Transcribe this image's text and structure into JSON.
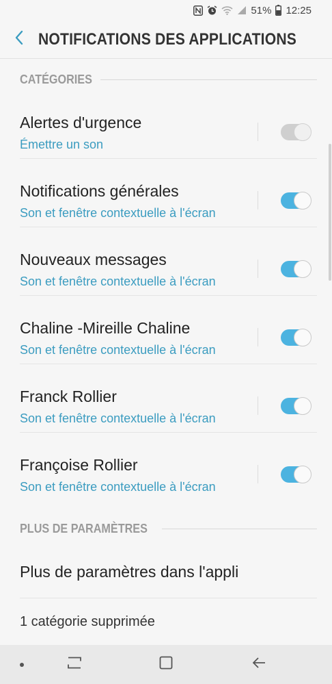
{
  "status_bar": {
    "battery": "51%",
    "time": "12:25",
    "icons": [
      "nfc-icon",
      "alarm-icon",
      "wifi-icon",
      "signal-icon",
      "battery-icon"
    ]
  },
  "header": {
    "back_icon": "chevron-left-icon",
    "title": "NOTIFICATIONS DES APPLICATIONS"
  },
  "sections": {
    "categories": "CATÉGORIES",
    "more_settings": "PLUS DE PARAMÈTRES"
  },
  "categories": [
    {
      "title": "Alertes d'urgence",
      "subtitle": "Émettre un son",
      "enabled": true,
      "toggle_disabled": true
    },
    {
      "title": "Notifications générales",
      "subtitle": "Son et fenêtre contextuelle à l'écran",
      "enabled": true,
      "toggle_disabled": false
    },
    {
      "title": "Nouveaux messages",
      "subtitle": "Son et fenêtre contextuelle à l'écran",
      "enabled": true,
      "toggle_disabled": false
    },
    {
      "title": "Chaline -Mireille Chaline",
      "subtitle": "Son et fenêtre contextuelle à l'écran",
      "enabled": true,
      "toggle_disabled": false
    },
    {
      "title": "Franck Rollier",
      "subtitle": "Son et fenêtre contextuelle à l'écran",
      "enabled": true,
      "toggle_disabled": false
    },
    {
      "title": "Françoise Rollier",
      "subtitle": "Son et fenêtre contextuelle à l'écran",
      "enabled": true,
      "toggle_disabled": false
    }
  ],
  "more": {
    "in_app_settings": "Plus de paramètres dans l'appli",
    "deleted_categories": "1 catégorie supprimée"
  },
  "nav_bar": {
    "icons": [
      "dot-icon",
      "recent-apps-icon",
      "home-icon",
      "back-arrow-icon"
    ]
  },
  "colors": {
    "accent": "#3b9cc0",
    "toggle_on": "#4cb3e0",
    "background": "#f6f6f6"
  }
}
